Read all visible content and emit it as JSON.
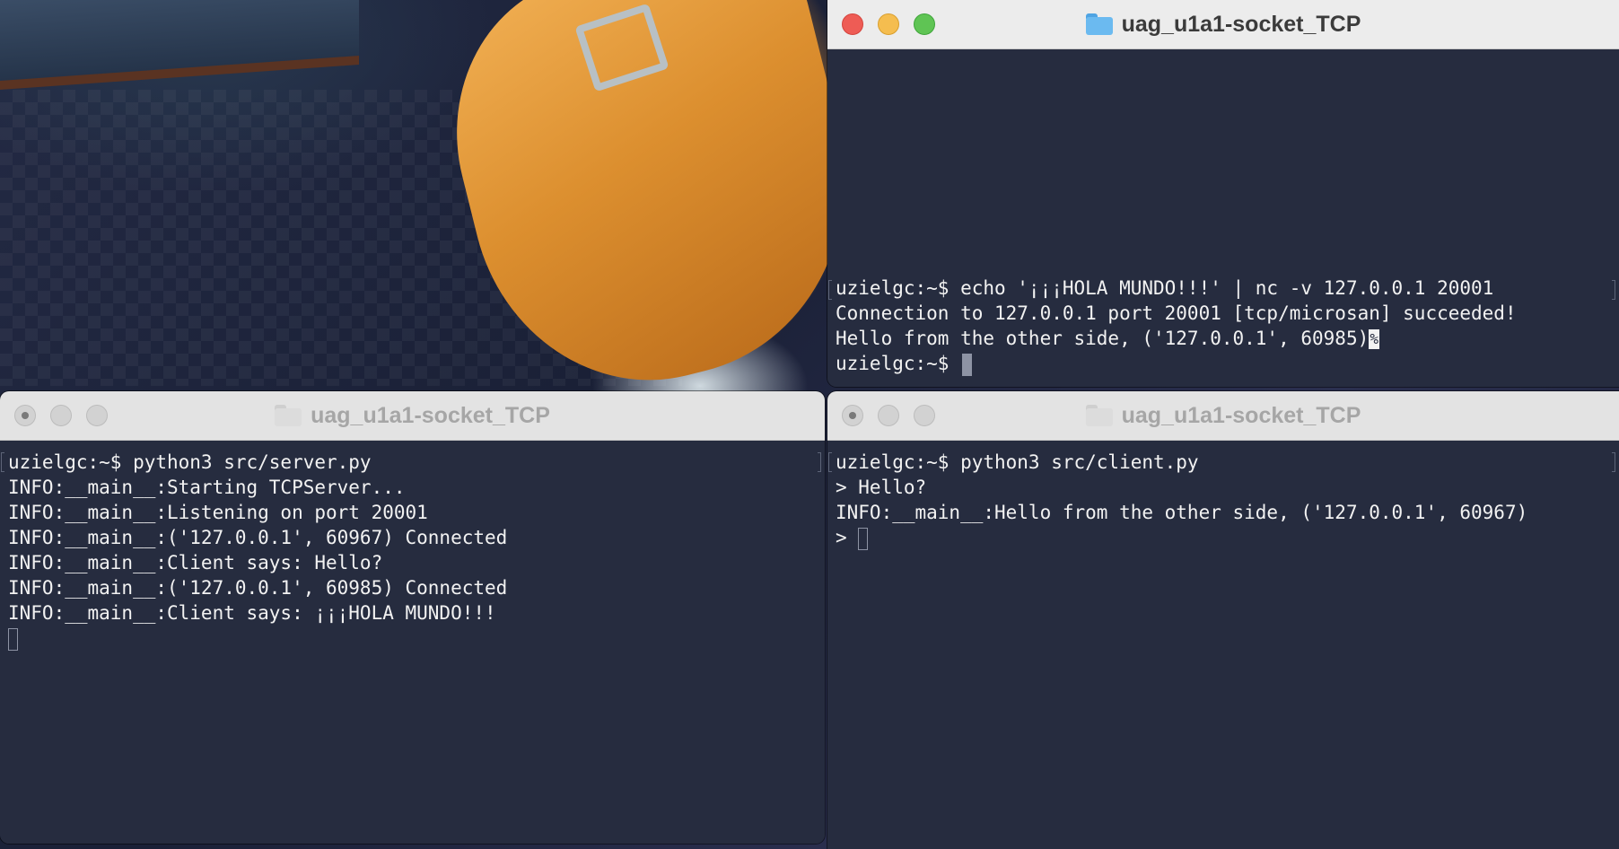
{
  "windows": {
    "top_right": {
      "title": "uag_u1a1-socket_TCP",
      "state": "active",
      "lines": [
        "uzielgc:~$ echo '¡¡¡HOLA MUNDO!!!' | nc -v 127.0.0.1 20001",
        "Connection to 127.0.0.1 port 20001 [tcp/microsan] succeeded!",
        "Hello from the other side, ('127.0.0.1', 60985)",
        "uzielgc:~$ "
      ],
      "end_of_output_mark": "%"
    },
    "bottom_left": {
      "title": "uag_u1a1-socket_TCP",
      "state": "inactive",
      "lines": [
        "uzielgc:~$ python3 src/server.py",
        "INFO:__main__:Starting TCPServer...",
        "INFO:__main__:Listening on port 20001",
        "INFO:__main__:('127.0.0.1', 60967) Connected",
        "INFO:__main__:Client says: Hello?",
        "INFO:__main__:('127.0.0.1', 60985) Connected",
        "INFO:__main__:Client says: ¡¡¡HOLA MUNDO!!!"
      ]
    },
    "bottom_right": {
      "title": "uag_u1a1-socket_TCP",
      "state": "inactive",
      "lines": [
        "uzielgc:~$ python3 src/client.py",
        "> Hello?",
        "INFO:__main__:Hello from the other side, ('127.0.0.1', 60967)",
        "> "
      ]
    }
  },
  "colors": {
    "terminal_bg": "#262c3f",
    "terminal_fg": "#f2f2f2",
    "titlebar_bg": "#ececec",
    "close": "#ee5c55",
    "minimize": "#f5bd4f",
    "maximize": "#5fc454",
    "folder": "#6bbaf0"
  },
  "icons": [
    "close-button",
    "minimize-button",
    "maximize-button",
    "folder-icon",
    "cursor"
  ]
}
